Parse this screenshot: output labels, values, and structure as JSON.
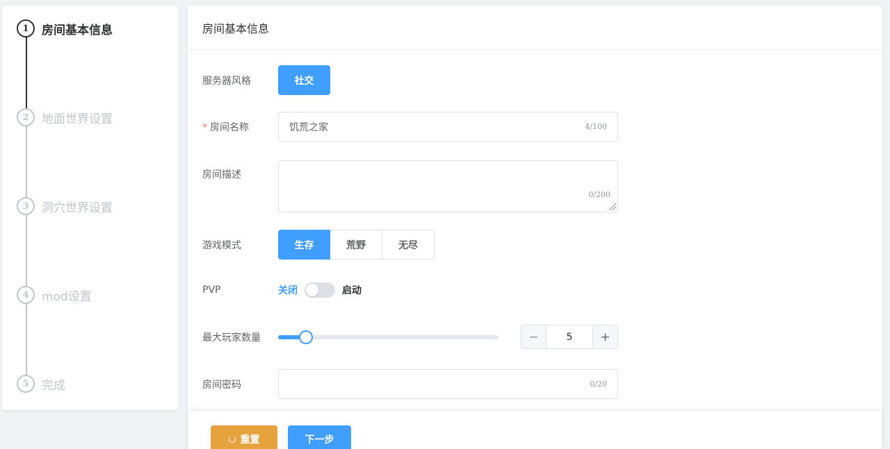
{
  "steps": [
    {
      "number": "1",
      "title": "房间基本信息",
      "active": true
    },
    {
      "number": "2",
      "title": "地面世界设置",
      "active": false
    },
    {
      "number": "3",
      "title": "洞穴世界设置",
      "active": false
    },
    {
      "number": "4",
      "title": "mod设置",
      "active": false
    },
    {
      "number": "5",
      "title": "完成",
      "active": false
    }
  ],
  "card": {
    "title": "房间基本信息"
  },
  "form": {
    "server_style": {
      "label": "服务器风格",
      "options": [
        "社交"
      ],
      "selected": "社交"
    },
    "room_name": {
      "label": "房间名称",
      "required_mark": "*",
      "value": "饥荒之家",
      "count": "4/100"
    },
    "room_desc": {
      "label": "房间描述",
      "value": "",
      "count": "0/200"
    },
    "game_mode": {
      "label": "游戏模式",
      "options": [
        "生存",
        "荒野",
        "无尽"
      ],
      "selected": "生存"
    },
    "pvp": {
      "label": "PVP",
      "off_text": "关闭",
      "on_text": "启动",
      "enabled": false
    },
    "max_players": {
      "label": "最大玩家数量",
      "value": "5",
      "minus": "−",
      "plus": "+",
      "slider_percent": 12.5
    },
    "password": {
      "label": "房间密码",
      "value": "",
      "count": "0/20"
    }
  },
  "footer": {
    "reset_label": "重置",
    "next_label": "下一步"
  },
  "colors": {
    "primary": "#409eff",
    "warning": "#e6a23c",
    "inactive": "#c0c4cc"
  }
}
